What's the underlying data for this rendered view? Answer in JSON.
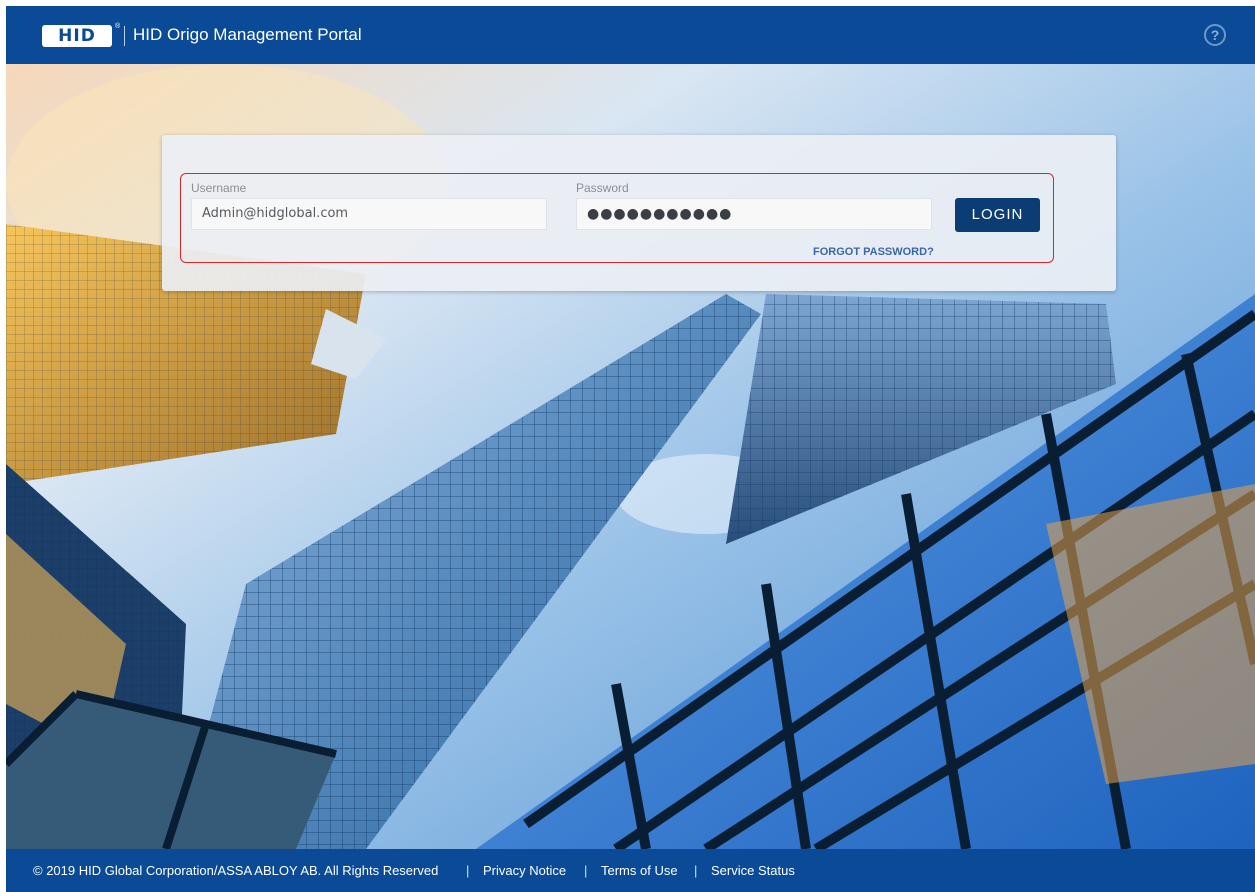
{
  "header": {
    "logo_text": "HID",
    "logo_reg": "®",
    "title": "HID Origo Management Portal",
    "help_glyph": "?"
  },
  "login": {
    "username_label": "Username",
    "username_value": "Admin@hidglobal.com",
    "password_label": "Password",
    "password_value": "●●●●●●●●●●●",
    "login_button": "LOGIN",
    "forgot_link": "FORGOT PASSWORD?"
  },
  "footer": {
    "copyright": "© 2019 HID Global Corporation/ASSA ABLOY AB. All Rights Reserved",
    "separator": "|",
    "privacy": "Privacy Notice",
    "terms": "Terms of Use",
    "status": "Service Status"
  },
  "colors": {
    "brand_blue": "#0a4a97",
    "button_navy": "#0b3d74",
    "highlight_red": "#d8262b",
    "link_blue": "#3b67a6"
  },
  "icons": {
    "help": "question-circle-icon",
    "background": "skyscrapers-photo"
  }
}
